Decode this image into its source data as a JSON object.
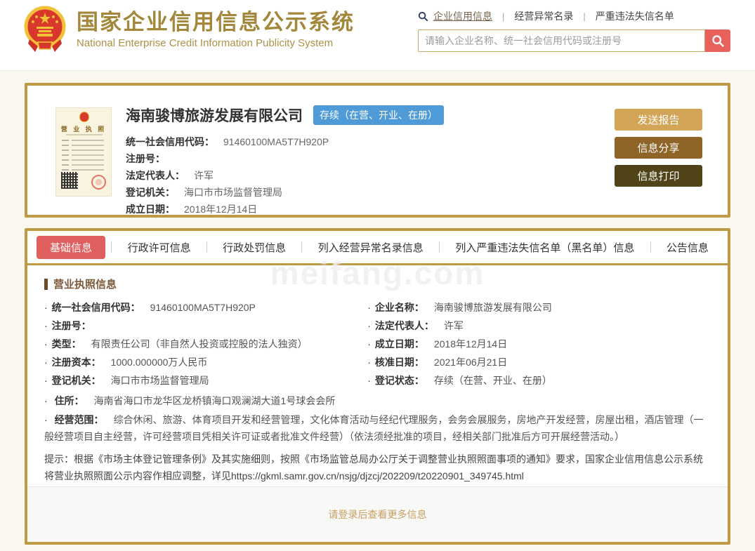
{
  "header": {
    "title": "国家企业信用信息公示系统",
    "subtitle": "National Enterprise Credit Information Publicity System",
    "nav_links": [
      {
        "label": "企业信用信息"
      },
      {
        "label": "经营异常名录"
      },
      {
        "label": "严重违法失信名单"
      }
    ],
    "search_placeholder": "请输入企业名称、统一社会信用代码或注册号",
    "icons": {
      "search": "search-icon",
      "emblem": "national-emblem-icon"
    }
  },
  "company_card": {
    "license_thumb_title": "营 业 执 照",
    "name": "海南骏博旅游发展有限公司",
    "status_badge": "存续（在营、开业、在册）",
    "fields": [
      {
        "label": "统一社会信用代码：",
        "value": "91460100MA5T7H920P"
      },
      {
        "label": "注册号：",
        "value": ""
      },
      {
        "label": "法定代表人：",
        "value": "许军"
      },
      {
        "label": "登记机关：",
        "value": "海口市市场监督管理局"
      },
      {
        "label": "成立日期：",
        "value": "2018年12月14日"
      }
    ],
    "buttons": [
      {
        "label": "发送报告"
      },
      {
        "label": "信息分享"
      },
      {
        "label": "信息打印"
      }
    ]
  },
  "tabs": [
    {
      "label": "基础信息"
    },
    {
      "label": "行政许可信息"
    },
    {
      "label": "行政处罚信息"
    },
    {
      "label": "列入经营异常名录信息"
    },
    {
      "label": "列入严重违法失信名单（黑名单）信息"
    },
    {
      "label": "公告信息"
    }
  ],
  "license_info": {
    "heading": "营业执照信息",
    "left_fields": [
      {
        "label": "统一社会信用代码：",
        "value": "91460100MA5T7H920P"
      },
      {
        "label": "注册号：",
        "value": ""
      },
      {
        "label": "类型：",
        "value": "有限责任公司（非自然人投资或控股的法人独资）"
      },
      {
        "label": "注册资本：",
        "value": "1000.000000万人民币"
      },
      {
        "label": "登记机关：",
        "value": "海口市市场监督管理局"
      }
    ],
    "right_fields": [
      {
        "label": "企业名称：",
        "value": "海南骏博旅游发展有限公司"
      },
      {
        "label": "法定代表人：",
        "value": "许军"
      },
      {
        "label": "成立日期：",
        "value": "2018年12月14日"
      },
      {
        "label": "核准日期：",
        "value": "2021年06月21日"
      },
      {
        "label": "登记状态：",
        "value": "存续（在营、开业、在册）"
      }
    ],
    "address": {
      "label": "住所：",
      "value": "海南省海口市龙华区龙桥镇海口观澜湖大道1号球会会所"
    },
    "business_scope": {
      "label": "经营范围：",
      "value": "综合休闲、旅游、体育项目开发和经营管理，文化体育活动与经纪代理服务，会务会展服务，房地产开发经营，房屋出租，酒店管理（一般经营项目自主经营，许可经营项目凭相关许可证或者批准文件经营）（依法须经批准的项目，经相关部门批准后方可开展经营活动。）"
    },
    "notice": "提示：根据《市场主体登记管理条例》及其实施细则，按照《市场监管总局办公厅关于调整营业执照照面事项的通知》要求，国家企业信用信息公示系统将营业执照照面公示内容作相应调整，详见https://gkml.samr.gov.cn/nsjg/djzcj/202209/t20220901_349745.html"
  },
  "footer": {
    "login_prompt": "请登录后查看更多信息"
  },
  "watermark": "meifang.com",
  "colors": {
    "gold_border": "#bf9a45",
    "title_gold": "#a3873a",
    "active_tab_red": "#e05f5f",
    "search_button_red": "#e9615c",
    "status_badge_blue": "#4e9bd8",
    "button_tan": "#d2a558",
    "button_brown": "#8f6527",
    "button_dark_brown": "#514318"
  }
}
